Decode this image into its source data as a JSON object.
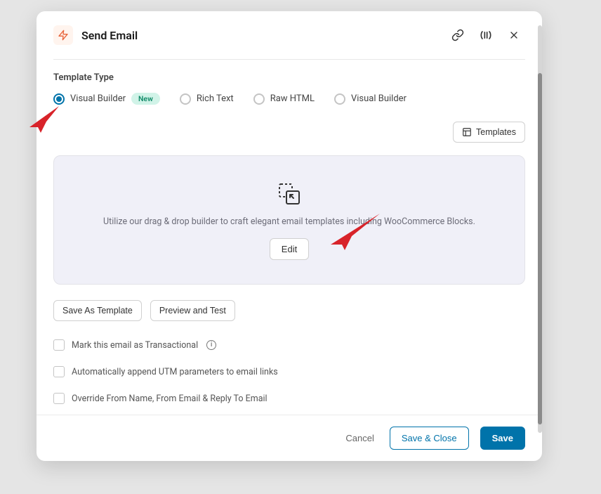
{
  "header": {
    "title": "Send Email"
  },
  "section": {
    "template_type_label": "Template Type",
    "radios": [
      {
        "label": "Visual Builder",
        "badge": "New",
        "selected": true
      },
      {
        "label": "Rich Text",
        "selected": false
      },
      {
        "label": "Raw HTML",
        "selected": false
      },
      {
        "label": "Visual Builder",
        "selected": false
      }
    ],
    "templates_btn": "Templates"
  },
  "builder": {
    "description": "Utilize our drag & drop builder to craft elegant email templates including WooCommerce Blocks.",
    "edit_btn": "Edit"
  },
  "actions": {
    "save_as_template": "Save As Template",
    "preview_and_test": "Preview and Test"
  },
  "checks": [
    {
      "label": "Mark this email as Transactional",
      "info": true
    },
    {
      "label": "Automatically append UTM parameters to email links",
      "info": false
    },
    {
      "label": "Override From Name, From Email & Reply To Email",
      "info": false
    }
  ],
  "footer": {
    "cancel": "Cancel",
    "save_close": "Save & Close",
    "save": "Save"
  }
}
